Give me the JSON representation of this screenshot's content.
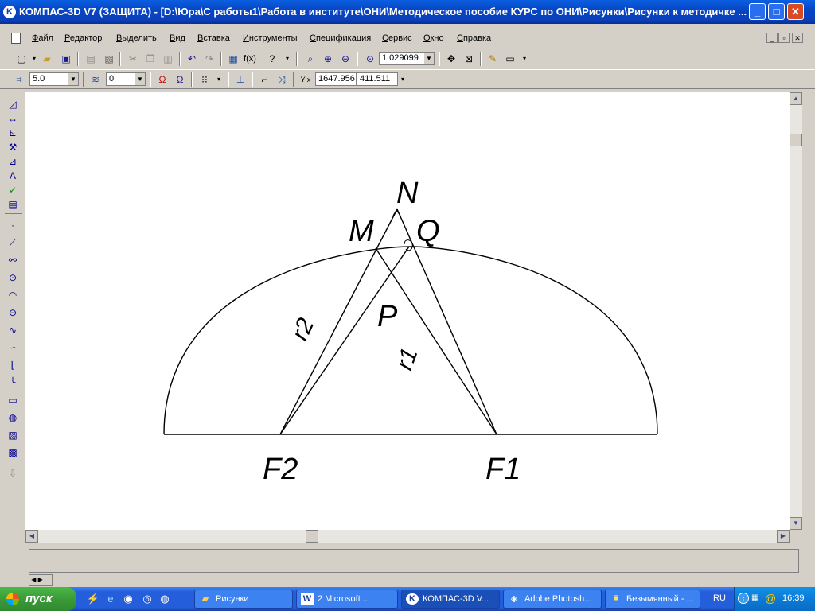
{
  "window": {
    "title": "КОМПАС-3D V7 (ЗАЩИТА) - [D:\\Юра\\С работы1\\Работа в институте\\ОНИ\\Методическое пособие КУРС по ОНИ\\Рисунки\\Рисунки к методичке ...",
    "icon_letter": "K"
  },
  "menu": [
    "Файл",
    "Редактор",
    "Выделить",
    "Вид",
    "Вставка",
    "Инструменты",
    "Спецификация",
    "Сервис",
    "Окно",
    "Справка"
  ],
  "toolbar1": {
    "zoom_value": "1.029099",
    "fx_label": "f(x)"
  },
  "toolbar2": {
    "step_value": "5.0",
    "layer_value": "0",
    "coord_x": "1647.956",
    "coord_y": "411.511",
    "coord_prefix": "Y x"
  },
  "drawing": {
    "labels": {
      "N": "N",
      "M": "M",
      "Q": "Q",
      "P": "P",
      "F1": "F1",
      "F2": "F2",
      "r1": "r1",
      "r2": "r2"
    }
  },
  "taskbar": {
    "start_label": "пуск",
    "tasks": [
      {
        "label": "Рисунки",
        "icon": "folder-icon"
      },
      {
        "label": "2 Microsoft ...",
        "icon": "word-icon"
      },
      {
        "label": "КОМПАС-3D V...",
        "icon": "kompas-icon",
        "active": true
      },
      {
        "label": "Adobe Photosh...",
        "icon": "photoshop-icon"
      },
      {
        "label": "Безымянный - ...",
        "icon": "paint-icon"
      }
    ],
    "lang": "RU",
    "clock": "16:39"
  }
}
